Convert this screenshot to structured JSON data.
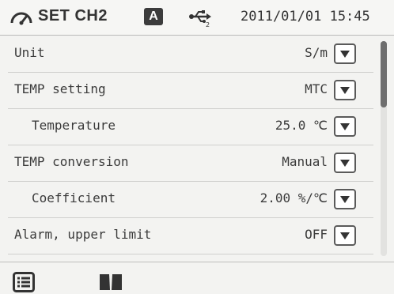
{
  "header": {
    "icon": "meter-gauge-icon",
    "title": "SET CH2",
    "mode_badge": "A",
    "usb_icon": "usb-icon",
    "datetime": "2011/01/01 15:45"
  },
  "settings": [
    {
      "label": "Unit",
      "value": "S/m",
      "indent": false
    },
    {
      "label": "TEMP setting",
      "value": "MTC",
      "indent": false
    },
    {
      "label": "Temperature",
      "value": "25.0 ℃",
      "indent": true
    },
    {
      "label": "TEMP conversion",
      "value": "Manual",
      "indent": false
    },
    {
      "label": "Coefficient",
      "value": "2.00 %/℃",
      "indent": true
    },
    {
      "label": "Alarm, upper limit",
      "value": "OFF",
      "indent": false
    }
  ],
  "scrollbar": {
    "position": 0.0,
    "visible_fraction": 0.31
  },
  "footer": {
    "left_icon": "menu-list-icon",
    "right_icon": "book-icon"
  },
  "colors": {
    "badge": "#3c3c3c",
    "text": "#3b3b3b",
    "divider": "#cfcfcd",
    "scroll_thumb": "#6e6e6e"
  }
}
